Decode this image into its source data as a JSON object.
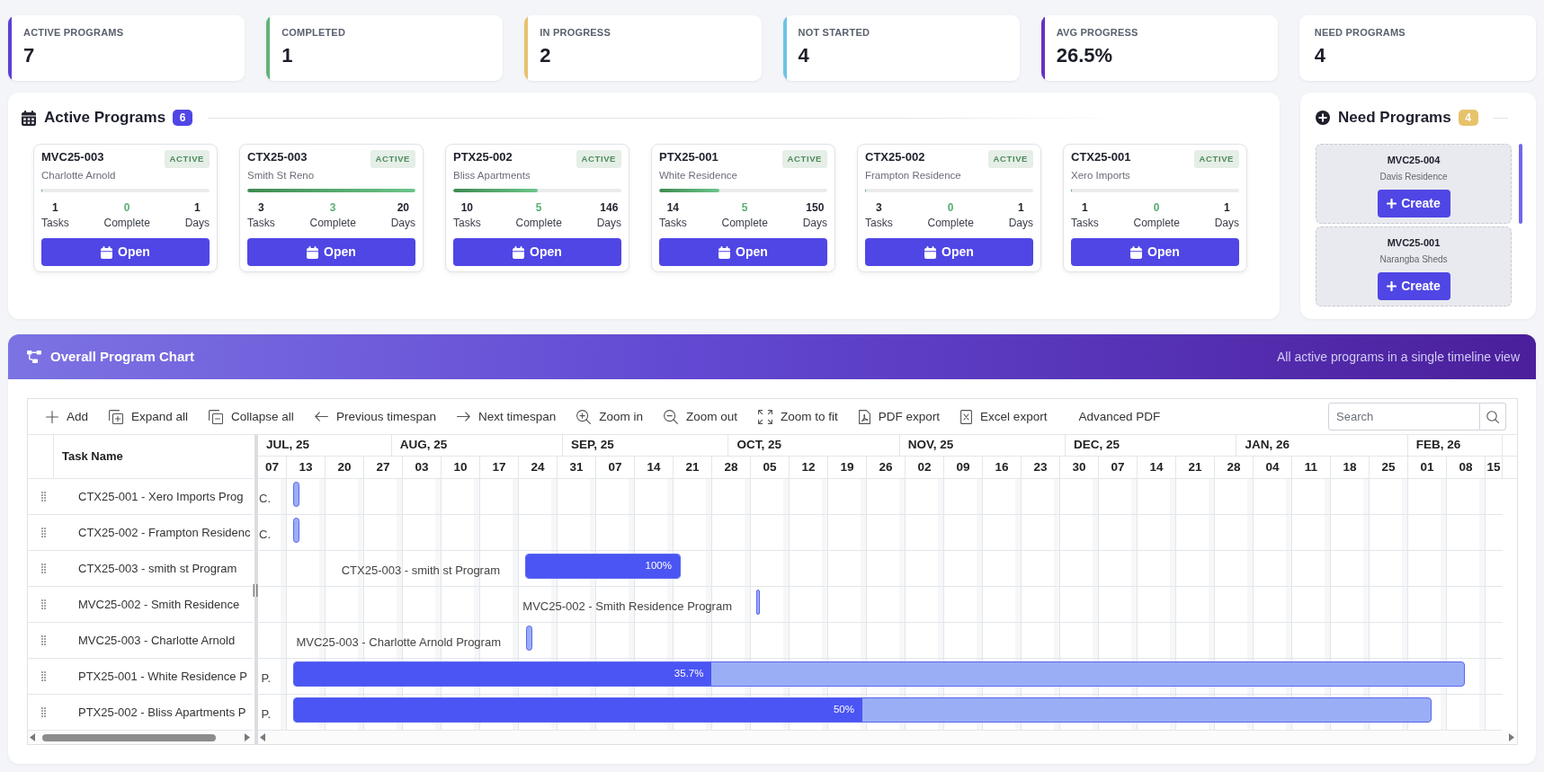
{
  "stats": [
    {
      "label": "ACTIVE PROGRAMS",
      "value": "7",
      "color": "#5b40d6"
    },
    {
      "label": "COMPLETED",
      "value": "1",
      "color": "#5fb37c"
    },
    {
      "label": "IN PROGRESS",
      "value": "2",
      "color": "#e6c26c"
    },
    {
      "label": "NOT STARTED",
      "value": "4",
      "color": "#6ec2e6"
    },
    {
      "label": "AVG PROGRESS",
      "value": "26.5%",
      "color": "#6a2ec6"
    },
    {
      "label": "NEED PROGRAMS",
      "value": "4"
    }
  ],
  "active_programs": {
    "title": "Active Programs",
    "count": "6",
    "programs": [
      {
        "code": "MVC25-003",
        "name": "Charlotte Arnold",
        "status": "ACTIVE",
        "level": 0,
        "tasks": "1",
        "tasks_label": "Tasks",
        "complete": "0",
        "complete_label": "Complete",
        "days": "1",
        "days_label": "Days",
        "button": "Open"
      },
      {
        "code": "CTX25-003",
        "name": "Smith St Reno",
        "status": "ACTIVE",
        "level": 1,
        "tasks": "3",
        "tasks_label": "Tasks",
        "complete": "3",
        "complete_label": "Complete",
        "days": "20",
        "days_label": "Days",
        "button": "Open"
      },
      {
        "code": "PTX25-002",
        "name": "Bliss Apartments",
        "status": "ACTIVE",
        "level": 0.5,
        "tasks": "10",
        "tasks_label": "Tasks",
        "complete": "5",
        "complete_label": "Complete",
        "days": "146",
        "days_label": "Days",
        "button": "Open"
      },
      {
        "code": "PTX25-001",
        "name": "White Residence",
        "status": "ACTIVE",
        "level": 0.357,
        "tasks": "14",
        "tasks_label": "Tasks",
        "complete": "5",
        "complete_label": "Complete",
        "days": "150",
        "days_label": "Days",
        "button": "Open"
      },
      {
        "code": "CTX25-002",
        "name": "Frampton Residence",
        "status": "ACTIVE",
        "level": 0,
        "tasks": "3",
        "tasks_label": "Tasks",
        "complete": "0",
        "complete_label": "Complete",
        "days": "1",
        "days_label": "Days",
        "button": "Open"
      },
      {
        "code": "CTX25-001",
        "name": "Xero Imports",
        "status": "ACTIVE",
        "level": 0,
        "tasks": "1",
        "tasks_label": "Tasks",
        "complete": "0",
        "complete_label": "Complete",
        "days": "1",
        "days_label": "Days",
        "button": "Open"
      }
    ]
  },
  "need_programs": {
    "title": "Need Programs",
    "count": "4",
    "items": [
      {
        "code": "MVC25-004",
        "name": "Davis Residence",
        "button": "Create"
      },
      {
        "code": "MVC25-001",
        "name": "Narangba Sheds",
        "button": "Create"
      }
    ]
  },
  "chart": {
    "title": "Overall Program Chart",
    "subtitle": "All active programs in a single timeline view",
    "toolbar": [
      {
        "kind": "add",
        "label": "Add"
      },
      {
        "kind": "expand",
        "label": "Expand all"
      },
      {
        "kind": "collapse",
        "label": "Collapse all"
      },
      {
        "kind": "previous",
        "label": "Previous timespan"
      },
      {
        "kind": "next",
        "label": "Next timespan"
      },
      {
        "kind": "zoom_in",
        "label": "Zoom in"
      },
      {
        "kind": "zoom_out",
        "label": "Zoom out"
      },
      {
        "kind": "fit",
        "label": "Zoom to fit"
      },
      {
        "kind": "pdf",
        "label": "PDF export"
      },
      {
        "kind": "excel",
        "label": "Excel export"
      },
      {
        "kind": "text",
        "label": "Advanced PDF"
      }
    ],
    "search": {
      "placeholder": "Search"
    },
    "column_header": "Task Name",
    "months": [
      "JUL, 25",
      "AUG, 25",
      "SEP, 25",
      "OCT, 25",
      "NOV, 25",
      "DEC, 25",
      "JAN, 26",
      "FEB, 26"
    ],
    "weeks": [
      "07",
      "13",
      "20",
      "27",
      "03",
      "10",
      "17",
      "24",
      "31",
      "07",
      "14",
      "21",
      "28",
      "05",
      "12",
      "19",
      "26",
      "02",
      "09",
      "16",
      "23",
      "30",
      "07",
      "14",
      "21",
      "28",
      "04",
      "11",
      "18",
      "25",
      "01",
      "08",
      "15"
    ],
    "tasks": [
      {
        "name": "CTX25-001 - Xero Imports Prog",
        "side_label": "C."
      },
      {
        "name": "CTX25-002 - Frampton Residenc",
        "side_label": "C."
      },
      {
        "name": "CTX25-003 - smith st Program",
        "side_label": "CTX25-003 - smith st Program",
        "level": 1,
        "progress_label": "100%"
      },
      {
        "name": "MVC25-002 - Smith Residence",
        "side_label": "MVC25-002 - Smith Residence Program"
      },
      {
        "name": "MVC25-003 - Charlotte Arnold",
        "side_label": "MVC25-003 - Charlotte Arnold Program"
      },
      {
        "name": "PTX25-001 - White Residence P",
        "side_label": "P.",
        "level": 0.357,
        "progress_label": "35.7%"
      },
      {
        "name": "PTX25-002 - Bliss Apartments P",
        "side_label": "P.",
        "level": 0.5,
        "progress_label": "50%"
      }
    ]
  }
}
